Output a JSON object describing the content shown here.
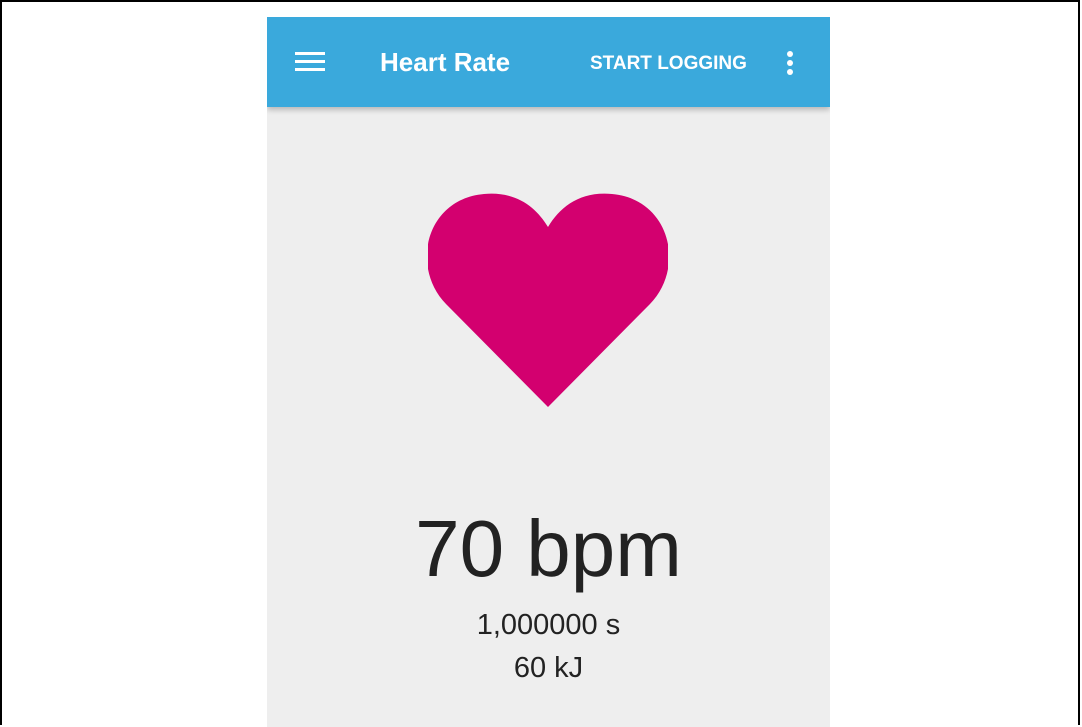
{
  "app_bar": {
    "title": "Heart Rate",
    "action_label": "START LOGGING",
    "menu_icon": "hamburger-menu-icon",
    "overflow_icon": "more-vert-icon",
    "background_color": "#3aa9dc",
    "text_color": "#ffffff"
  },
  "heart": {
    "icon": "heart-icon",
    "color": "#d3006f"
  },
  "readings": {
    "heart_rate": "70 bpm",
    "time": "1,000000 s",
    "energy": "60 kJ"
  },
  "colors": {
    "content_background": "#eeeeee",
    "text": "#222222"
  }
}
